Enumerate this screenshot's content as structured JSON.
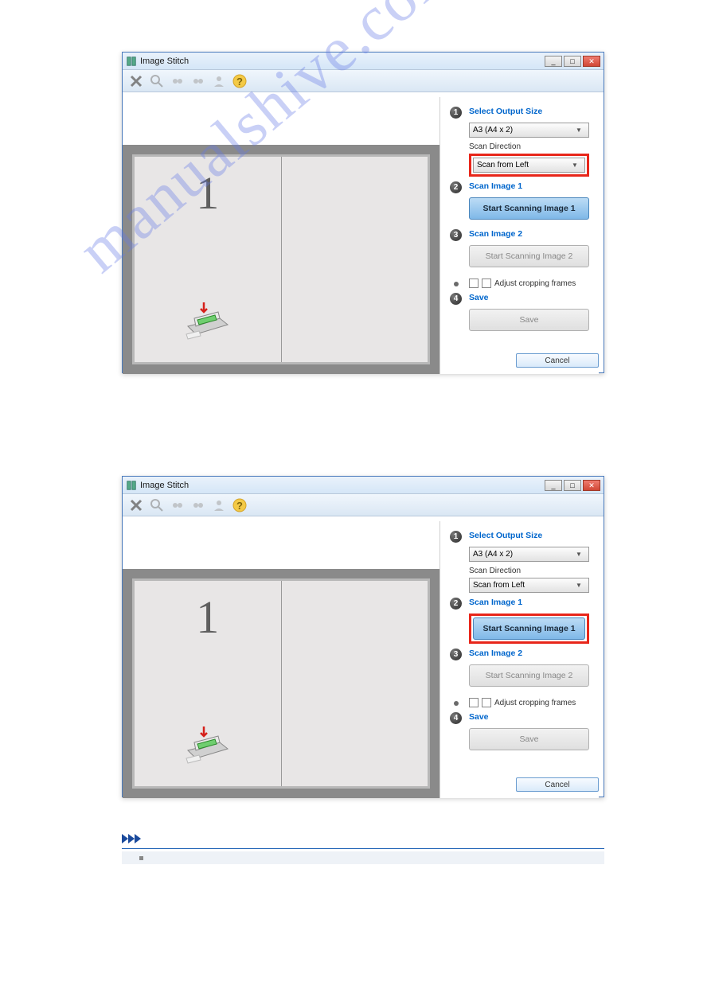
{
  "watermark": "manualshive.com",
  "dialog": {
    "title": "Image Stitch",
    "window_controls": {
      "min": "_",
      "max": "□",
      "close": "✕"
    },
    "toolbar": {
      "delete_icon": "x-icon",
      "zoom_icon": "magnifier-icon",
      "rotate_l_icon": "rotate-left-icon",
      "rotate_r_icon": "rotate-right-icon",
      "crop_icon": "person-icon",
      "help_icon": "help-icon"
    },
    "preview": {
      "page_number": "1"
    },
    "steps": {
      "s1": {
        "num": "1",
        "label": "Select Output Size",
        "output_size_value": "A3 (A4 x 2)",
        "scan_direction_label": "Scan Direction",
        "scan_direction_value": "Scan from Left"
      },
      "s2": {
        "num": "2",
        "label": "Scan Image 1",
        "button": "Start Scanning Image 1"
      },
      "s3": {
        "num": "3",
        "label": "Scan Image 2",
        "button": "Start Scanning Image 2"
      },
      "crop_checkbox": "Adjust cropping frames",
      "s4": {
        "num": "4",
        "label": "Save",
        "button": "Save"
      }
    },
    "footer": {
      "cancel": "Cancel"
    }
  }
}
